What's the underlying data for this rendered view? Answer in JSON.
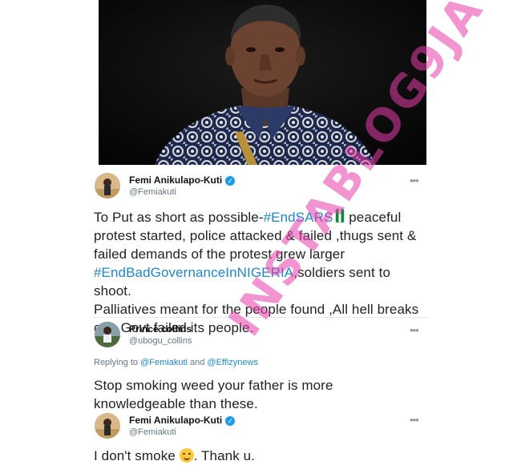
{
  "tweet1": {
    "name": "Femi Anikulapo-Kuti",
    "handle": "@Femiakuti",
    "lines": [
      {
        "pre": "To Put as short as possible-",
        "tag": "#EndSARS",
        "post": " peaceful"
      },
      {
        "pre": "protest started, police attacked & failed ,thugs sent &",
        "tag": "",
        "post": ""
      },
      {
        "pre": "failed demands of the protest grew larger",
        "tag": "",
        "post": ""
      },
      {
        "pre": "",
        "tag": "#EndBadGovernanceInNIGERIA",
        "post": ",soldiers sent to shoot."
      },
      {
        "pre": "Palliatives meant for the people found ,All hell breaks",
        "tag": "",
        "post": ""
      },
      {
        "pre": "out. Govt failed its people.",
        "tag": "",
        "post": ""
      }
    ]
  },
  "reply1": {
    "name": "Prince collins",
    "handle": "@ubogu_collins",
    "replying_prefix": "Replying to ",
    "mention1": "@Femiakuti",
    "and_text": " and ",
    "mention2": "@Effizynews",
    "line1": "Stop smoking weed your father is more",
    "line2": "knowledgeable than these."
  },
  "reply2": {
    "name": "Femi Anikulapo-Kuti",
    "handle": "@Femiakuti",
    "text_before": "I don't smoke ",
    "text_after": ". Thank u."
  },
  "more_label": "•••",
  "verified_mark": "✓",
  "watermark": "INSTABLOG9JA",
  "colors": {
    "hashtag": "#1d88c9",
    "verified": "#1d9bf0",
    "watermark": "#e63caa"
  },
  "icons": {
    "emoji": "smiling-face-icon",
    "flag": "nigeria-flag-icon"
  }
}
